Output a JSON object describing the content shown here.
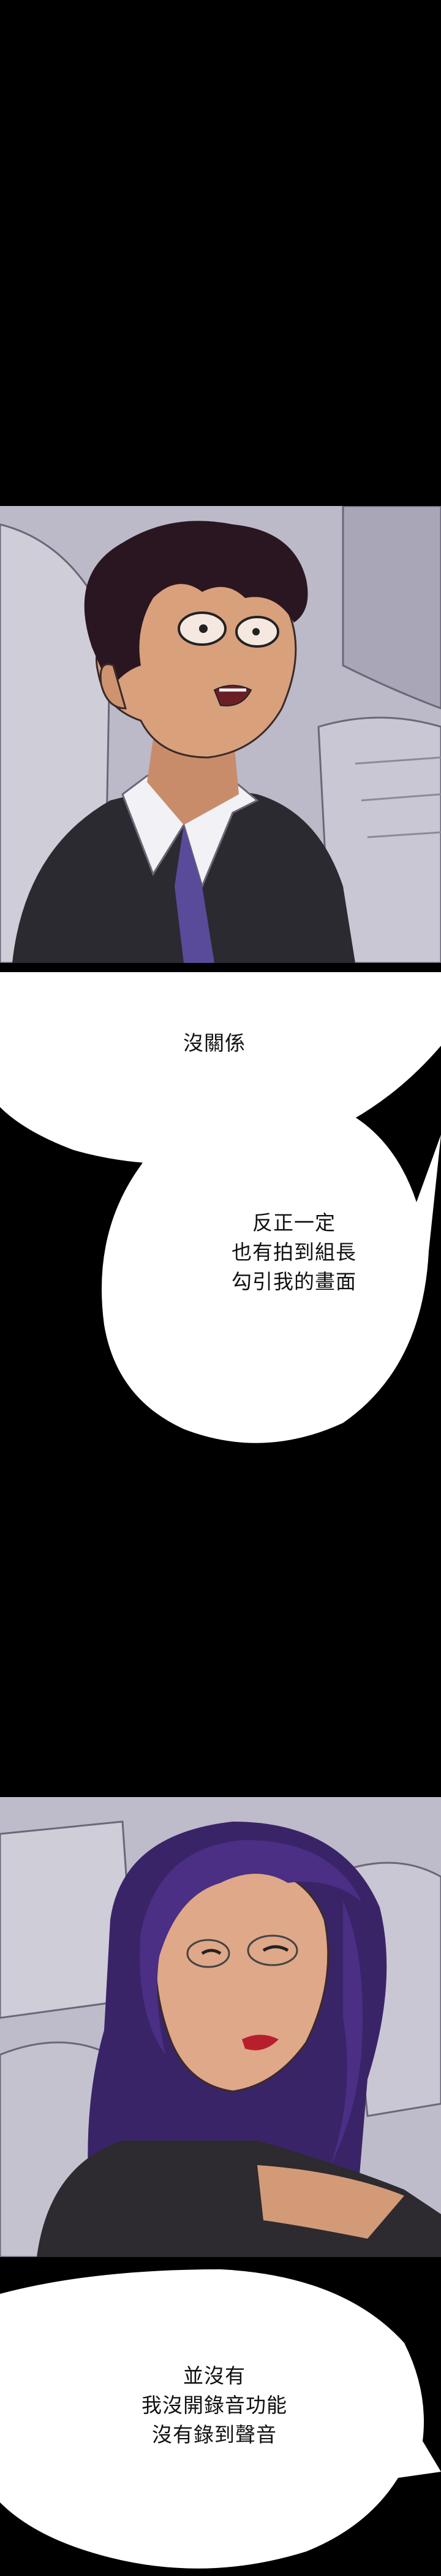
{
  "panels": [
    {
      "id": "panel-1",
      "characters": [
        "man-with-glasses"
      ]
    },
    {
      "id": "panel-2",
      "characters": [
        "woman-with-glasses"
      ]
    }
  ],
  "bubbles": [
    {
      "id": "bubble-1",
      "lines": [
        "沒關係"
      ]
    },
    {
      "id": "bubble-2",
      "lines": [
        "反正一定",
        "也有拍到組長",
        "勾引我的畫面"
      ]
    },
    {
      "id": "bubble-3",
      "lines": [
        "並沒有",
        "我沒開錄音功能",
        "沒有錄到聲音"
      ]
    }
  ],
  "colors": {
    "background": "#000000",
    "bubble": "#ffffff",
    "text": "#111111",
    "panel_bg": "#b9b8c6",
    "hair_man": "#2a1620",
    "hair_woman": "#3a2468",
    "skin": "#d9a07c",
    "suit": "#2b2a30"
  }
}
